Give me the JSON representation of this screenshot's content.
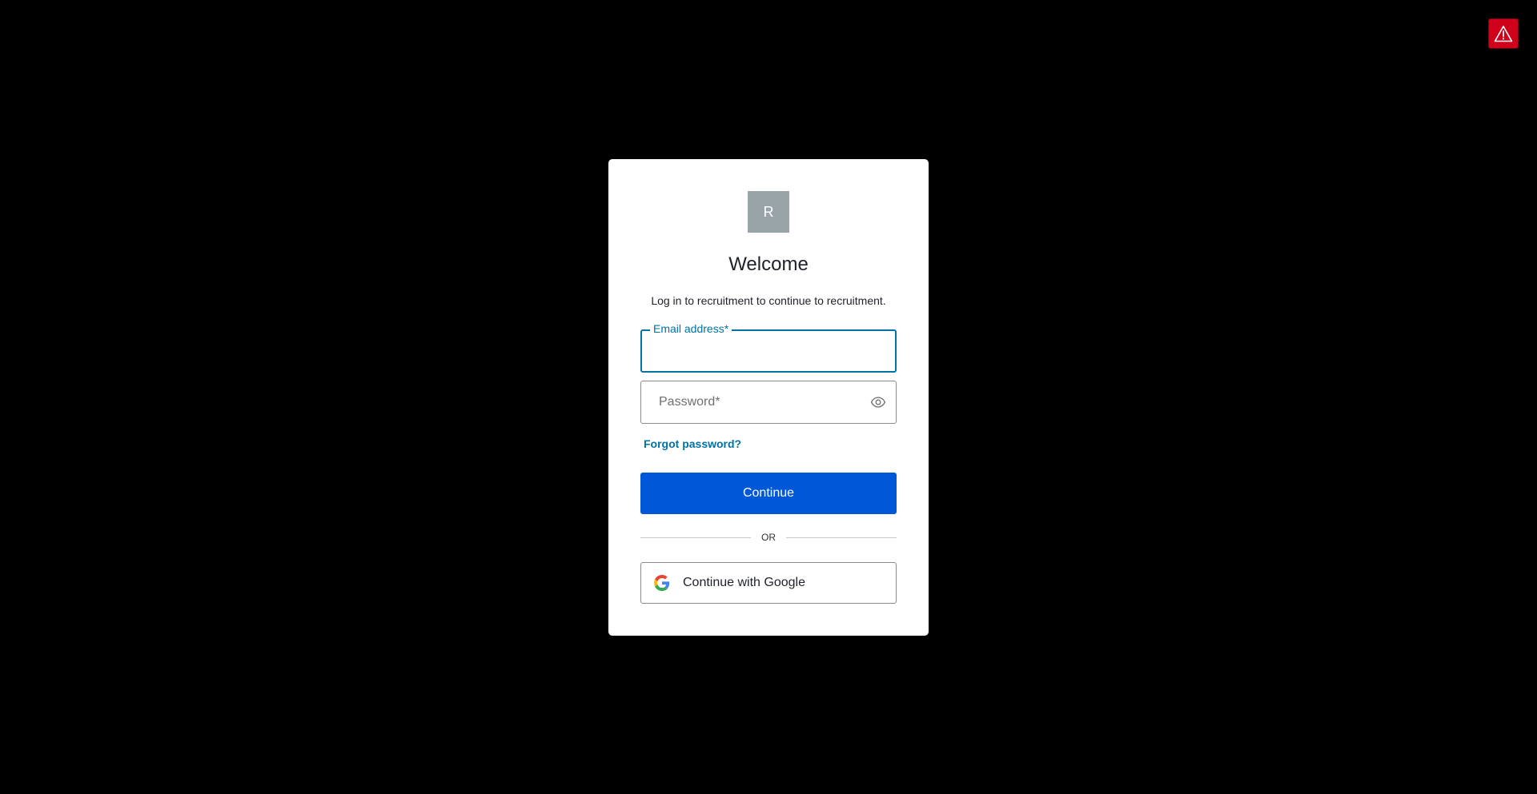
{
  "alert": {
    "icon": "warning-icon",
    "color": "#d0021b"
  },
  "logo": {
    "letter": "R",
    "color": "#98a4a8"
  },
  "login": {
    "title": "Welcome",
    "subtitle": "Log in to recruitment to continue to recruitment.",
    "email": {
      "label": "Email address*",
      "value": ""
    },
    "password": {
      "placeholder": "Password*",
      "value": "",
      "toggle_icon": "eye-icon"
    },
    "forgot_label": "Forgot password?",
    "continue_label": "Continue",
    "divider_label": "OR",
    "google_label": "Continue with Google",
    "google_icon": "google-icon"
  },
  "colors": {
    "background": "#000000",
    "primary": "#0057d8",
    "link": "#0072a3",
    "focus_border": "#0072a3"
  }
}
